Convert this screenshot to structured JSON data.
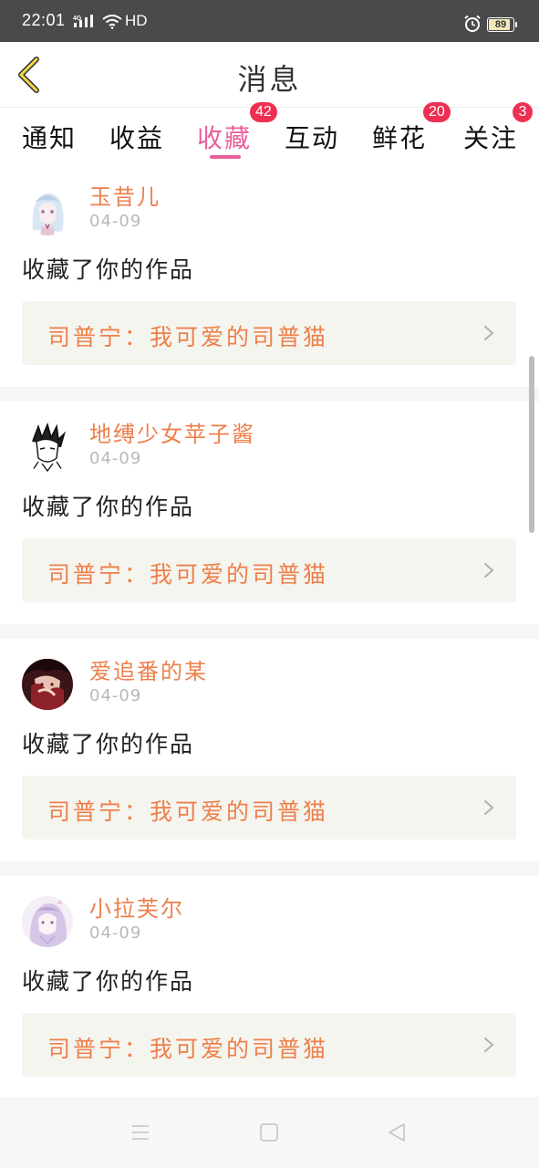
{
  "status_bar": {
    "time": "22:01",
    "network_label": "4G",
    "hd_label": "HD",
    "battery": "89"
  },
  "header": {
    "title": "消息"
  },
  "tabs": [
    {
      "label": "通知",
      "badge": ""
    },
    {
      "label": "收益",
      "badge": ""
    },
    {
      "label": "收藏",
      "badge": "42",
      "active": true
    },
    {
      "label": "互动",
      "badge": ""
    },
    {
      "label": "鲜花",
      "badge": "20"
    },
    {
      "label": "关注",
      "badge": "3"
    }
  ],
  "messages": [
    {
      "username": "玉昔儿",
      "date": "04-09",
      "action": "收藏了你的作品",
      "work": "司普宁：我可爱的司普猫",
      "avatar_icon": "anime-girl-avatar-icon"
    },
    {
      "username": "地缚少女苹子酱",
      "date": "04-09",
      "action": "收藏了你的作品",
      "work": "司普宁：我可爱的司普猫",
      "avatar_icon": "sketch-character-avatar-icon"
    },
    {
      "username": "爱追番的某",
      "date": "04-09",
      "action": "收藏了你的作品",
      "work": "司普宁：我可爱的司普猫",
      "avatar_icon": "dark-red-character-avatar-icon"
    },
    {
      "username": "小拉芙尔",
      "date": "04-09",
      "action": "收藏了你的作品",
      "work": "司普宁：我可爱的司普猫",
      "avatar_icon": "lavender-girl-avatar-icon"
    }
  ],
  "colors": {
    "accent_pink": "#e8609a",
    "username_orange": "#ee7f4b",
    "badge_red": "#ee2f52",
    "link_bg": "#f5f5ef"
  },
  "nav": {
    "menu_icon": "menu-icon",
    "home_icon": "home-square-icon",
    "back_icon": "back-triangle-icon"
  }
}
